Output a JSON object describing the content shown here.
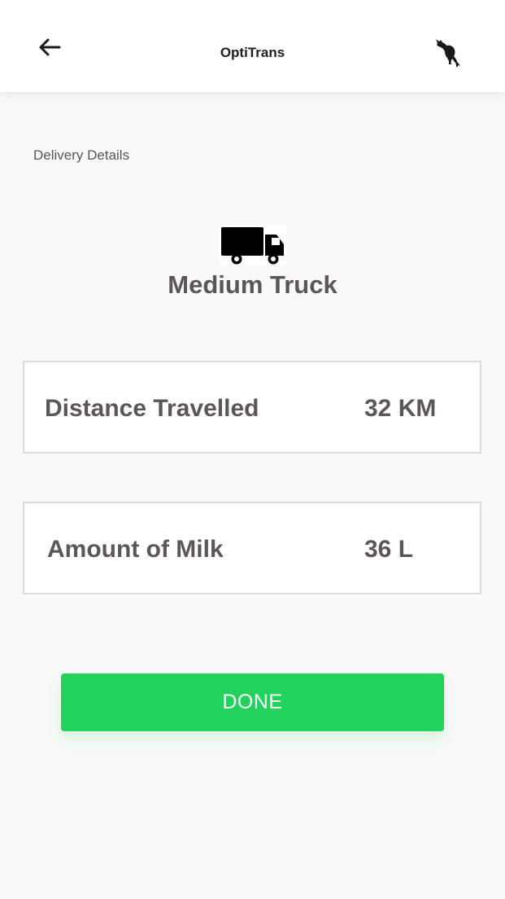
{
  "header": {
    "title": "OptiTrans",
    "back_icon": "arrow-left-icon",
    "logo_icon": "kangaroo-logo-icon"
  },
  "section": {
    "label": "Delivery Details"
  },
  "vehicle": {
    "icon": "truck-icon",
    "name": "Medium Truck"
  },
  "details": [
    {
      "label": "Distance Travelled",
      "value": "32 KM"
    },
    {
      "label": "Amount of Milk",
      "value": "36 L"
    }
  ],
  "actions": {
    "done_label": "DONE"
  },
  "colors": {
    "accent": "#23d25d",
    "text_primary": "#5d5657",
    "background": "#f9f9f9"
  }
}
